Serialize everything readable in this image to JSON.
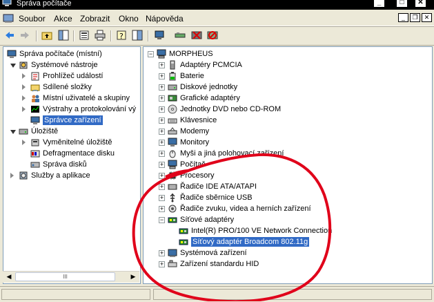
{
  "window": {
    "title": "Správa počítače"
  },
  "menu": [
    "Soubor",
    "Akce",
    "Zobrazit",
    "Okno",
    "Nápověda"
  ],
  "left_tree": [
    {
      "label": "Správa počítače (místní)",
      "level": 0,
      "exp": "none",
      "icon": "computer-management-icon"
    },
    {
      "label": "Systémové nástroje",
      "level": 1,
      "exp": "open",
      "icon": "system-tools-icon"
    },
    {
      "label": "Prohlížeč událostí",
      "level": 2,
      "exp": "closed",
      "icon": "event-viewer-icon"
    },
    {
      "label": "Sdílené složky",
      "level": 2,
      "exp": "closed",
      "icon": "shared-folder-icon"
    },
    {
      "label": "Místní uživatelé a skupiny",
      "level": 2,
      "exp": "closed",
      "icon": "users-icon"
    },
    {
      "label": "Výstrahy a protokolování vý",
      "level": 2,
      "exp": "closed",
      "icon": "performance-icon"
    },
    {
      "label": "Správce zařízení",
      "level": 2,
      "exp": "none",
      "icon": "device-manager-icon",
      "selected": true
    },
    {
      "label": "Úložiště",
      "level": 1,
      "exp": "open",
      "icon": "storage-icon"
    },
    {
      "label": "Vyměnitelné úložiště",
      "level": 2,
      "exp": "closed",
      "icon": "removable-storage-icon"
    },
    {
      "label": "Defragmentace disku",
      "level": 2,
      "exp": "none",
      "icon": "defrag-icon"
    },
    {
      "label": "Správa disků",
      "level": 2,
      "exp": "none",
      "icon": "disk-management-icon"
    },
    {
      "label": "Služby a aplikace",
      "level": 1,
      "exp": "closed",
      "icon": "services-icon"
    }
  ],
  "right_tree": [
    {
      "label": "MORPHEUS",
      "level": 0,
      "exp": "open",
      "icon": "computer-icon"
    },
    {
      "label": "Adaptéry PCMCIA",
      "level": 1,
      "exp": "plus",
      "icon": "pcmcia-icon"
    },
    {
      "label": "Baterie",
      "level": 1,
      "exp": "plus",
      "icon": "battery-icon"
    },
    {
      "label": "Diskové jednotky",
      "level": 1,
      "exp": "plus",
      "icon": "disk-drive-icon"
    },
    {
      "label": "Grafické adaptéry",
      "level": 1,
      "exp": "plus",
      "icon": "display-adapter-icon"
    },
    {
      "label": "Jednotky DVD nebo CD-ROM",
      "level": 1,
      "exp": "plus",
      "icon": "dvd-icon"
    },
    {
      "label": "Klávesnice",
      "level": 1,
      "exp": "plus",
      "icon": "keyboard-icon"
    },
    {
      "label": "Modemy",
      "level": 1,
      "exp": "plus",
      "icon": "modem-icon"
    },
    {
      "label": "Monitory",
      "level": 1,
      "exp": "plus",
      "icon": "monitor-icon"
    },
    {
      "label": "Myši a jiná polohovací zařízení",
      "level": 1,
      "exp": "plus",
      "icon": "mouse-icon"
    },
    {
      "label": "Počítač",
      "level": 1,
      "exp": "plus",
      "icon": "computer-icon"
    },
    {
      "label": "Procesory",
      "level": 1,
      "exp": "plus",
      "icon": "processor-icon"
    },
    {
      "label": "Řadiče IDE ATA/ATAPI",
      "level": 1,
      "exp": "plus",
      "icon": "ide-controller-icon"
    },
    {
      "label": "Řadiče sběrnice USB",
      "level": 1,
      "exp": "plus",
      "icon": "usb-icon"
    },
    {
      "label": "Řadiče zvuku, videa a herních zařízení",
      "level": 1,
      "exp": "plus",
      "icon": "sound-icon"
    },
    {
      "label": "Síťové adaptéry",
      "level": 1,
      "exp": "minus",
      "icon": "network-adapter-icon"
    },
    {
      "label": "Intel(R) PRO/100 VE Network Connection",
      "level": 2,
      "exp": "none",
      "icon": "network-adapter-icon"
    },
    {
      "label": "Síťový adaptér Broadcom 802.11g",
      "level": 2,
      "exp": "none",
      "icon": "network-adapter-icon",
      "selected": true
    },
    {
      "label": "Systémová zařízení",
      "level": 1,
      "exp": "plus",
      "icon": "system-device-icon"
    },
    {
      "label": "Zařízení standardu HID",
      "level": 1,
      "exp": "plus",
      "icon": "hid-icon"
    }
  ],
  "scrollbar": {
    "thumb_label": "III"
  },
  "colors": {
    "selection": "#316ac5",
    "annotation": "#e0001a",
    "window_bg": "#ece9d8"
  }
}
